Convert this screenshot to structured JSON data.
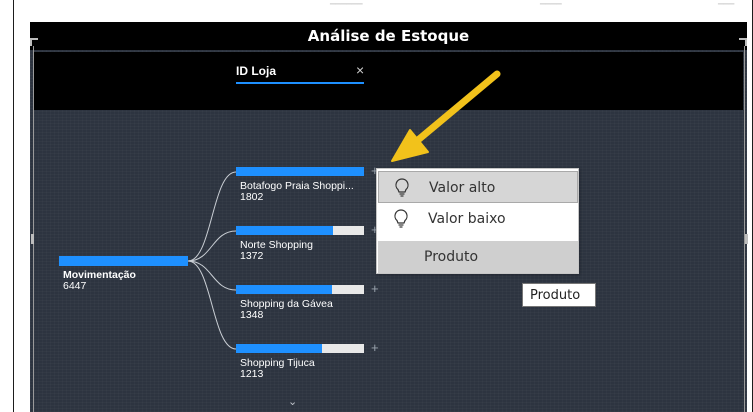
{
  "visual": {
    "title": "Análise de Estoque"
  },
  "breadcrumb": {
    "level_label": "ID Loja",
    "close_glyph": "×"
  },
  "tree": {
    "root": {
      "label": "Movimentação",
      "value": "6447"
    },
    "children": [
      {
        "label": "Botafogo Praia Shoppi...",
        "value": "1802",
        "fill": 1.0
      },
      {
        "label": "Norte Shopping",
        "value": "1372",
        "fill": 0.76
      },
      {
        "label": "Shopping da Gávea",
        "value": "1348",
        "fill": 0.75
      },
      {
        "label": "Shopping Tijuca",
        "value": "1213",
        "fill": 0.67
      }
    ],
    "expand_glyph": "+",
    "scroll_glyph": "⌄"
  },
  "context_menu": {
    "items": [
      {
        "label": "Valor alto",
        "icon": "lightbulb-icon"
      },
      {
        "label": "Valor baixo",
        "icon": "lightbulb-icon"
      },
      {
        "label": "Produto"
      }
    ]
  },
  "tooltip": {
    "text": "Produto"
  },
  "colors": {
    "bar_fill": "#1e90ff",
    "bar_track": "#e8e8e8",
    "annotation_arrow": "#f2c21b",
    "canvas": "#2d3440"
  }
}
